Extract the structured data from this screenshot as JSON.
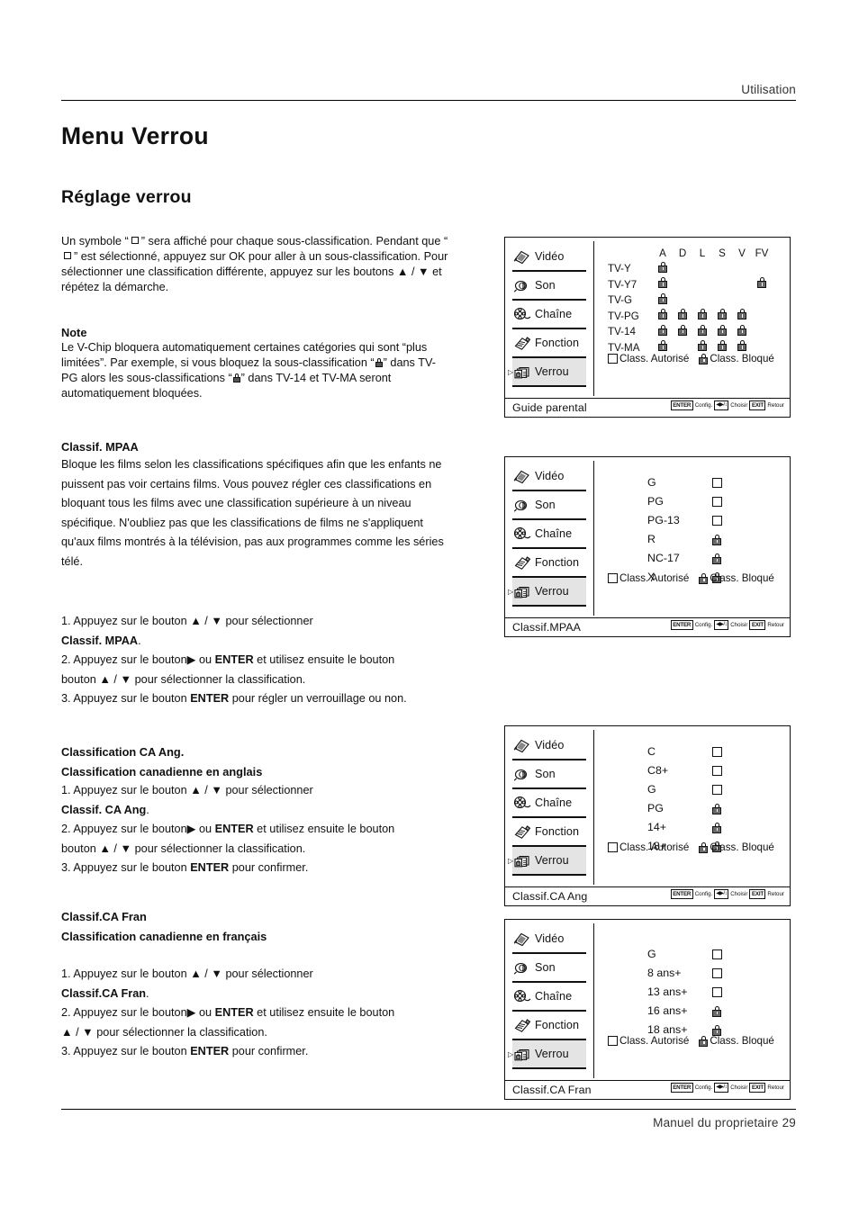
{
  "header": {
    "section": "Utilisation"
  },
  "footer": {
    "text": "Manuel du proprietaire 29"
  },
  "titles": {
    "h1": "Menu Verrou",
    "h2": "Réglage verrou"
  },
  "intro": {
    "p1_a": "Un symbole “",
    "p1_b": "” sera affiché pour chaque sous-classification. Pendant que “",
    "p1_c": "” est sélectionné, appuyez sur OK pour aller à un sous-classification. Pour sélectionner une classification différente, appuyez sur les boutons",
    "p1_d": "et répétez la démarche."
  },
  "note": {
    "title": "Note",
    "a": "Le V-Chip bloquera automatiquement certaines catégories qui sont “plus limitées”.  Par exemple, si vous bloquez la sous-classification “",
    "b": "” dans TV-PG alors les sous-classifications “",
    "c": "” dans TV-14 et TV-MA seront automatiquement bloquées."
  },
  "mpaa": {
    "title": "Classif. MPAA",
    "body": "Bloque les films selon les classifications spécifiques afin que les enfants ne puissent pas voir certains films. Vous pouvez régler ces classifications en bloquant tous les films avec une classification supérieure à un niveau spécifique. N'oubliez pas que les classifications de films ne s'appliquent qu'aux films montrés à la télévision, pas aux programmes comme les séries télé.",
    "step1_a": "1. Appuyez sur le bouton",
    "step1_b": "pour sélectionner",
    "step1_target": "Classif. MPAA",
    "step2_a": "2. Appuyez sur le bouton",
    "step2_b": "ou",
    "step2_enter": "ENTER",
    "step2_c": "et utilisez ensuite le bouton",
    "step2_d": "pour sélectionner la classification.",
    "step3_a": "3. Appuyez sur le bouton",
    "step3_enter": "ENTER",
    "step3_b": "pour régler un verrouillage ou non."
  },
  "ca_ang": {
    "title1": "Classification CA Ang.",
    "title2": "Classification canadienne en anglais",
    "step1_a": "1. Appuyez sur le bouton",
    "step1_b": "pour sélectionner",
    "step1_target": "Classif. CA Ang",
    "step2_a": "2. Appuyez sur le bouton",
    "step2_b": "ou",
    "step2_enter": "ENTER",
    "step2_c": "et utilisez ensuite le bouton",
    "step2_d": "pour sélectionner la classification.",
    "step3_a": "3. Appuyez sur le bouton",
    "step3_enter": "ENTER",
    "step3_b": "pour confirmer."
  },
  "ca_fran": {
    "title1": "Classif.CA Fran",
    "title2": "Classification canadienne en français",
    "step1_a": "1. Appuyez sur le bouton",
    "step1_b": "pour sélectionner",
    "step1_target": "Classif.CA Fran",
    "step2_a": "2. Appuyez sur le bouton",
    "step2_b": "ou",
    "step2_enter": "ENTER",
    "step2_c": "et utilisez ensuite le bouton",
    "step2_d": "pour sélectionner la classification.",
    "step3_a": "3. Appuyez sur le bouton",
    "step3_enter": "ENTER",
    "step3_b": "pour confirmer."
  },
  "osd_menu": {
    "items": [
      {
        "label": "Vidéo",
        "icon": "video-icon",
        "selected": false
      },
      {
        "label": "Son",
        "icon": "sound-icon",
        "selected": false
      },
      {
        "label": "Chaîne",
        "icon": "channel-icon",
        "selected": false
      },
      {
        "label": "Fonction",
        "icon": "function-icon",
        "selected": false
      },
      {
        "label": "Verrou",
        "icon": "lock-icon",
        "selected": true
      }
    ]
  },
  "osd_legend": {
    "allowed": "Class. Autorisé",
    "blocked": "Class. Bloqué"
  },
  "osd_keys": {
    "enter": "ENTER",
    "config": "Config.",
    "dirs": "◀▶/↕",
    "choose": "Choisir",
    "exit": "EXIT",
    "back": "Retour"
  },
  "panel1": {
    "footer_title": "Guide parental",
    "columns": [
      "A",
      "D",
      "L",
      "S",
      "V",
      "FV"
    ],
    "rows": [
      {
        "label": "TV-Y",
        "locks": [
          1,
          0,
          0,
          0,
          0,
          0
        ]
      },
      {
        "label": "TV-Y7",
        "locks": [
          1,
          0,
          0,
          0,
          0,
          1
        ]
      },
      {
        "label": "TV-G",
        "locks": [
          1,
          0,
          0,
          0,
          0,
          0
        ]
      },
      {
        "label": "TV-PG",
        "locks": [
          1,
          1,
          1,
          1,
          1,
          0
        ]
      },
      {
        "label": "TV-14",
        "locks": [
          1,
          1,
          1,
          1,
          1,
          0
        ]
      },
      {
        "label": "TV-MA",
        "locks": [
          1,
          0,
          1,
          1,
          1,
          0
        ]
      }
    ]
  },
  "panel2": {
    "footer_title": "Classif.MPAA",
    "rows": [
      {
        "label": "G",
        "state": "allowed"
      },
      {
        "label": "PG",
        "state": "allowed"
      },
      {
        "label": "PG-13",
        "state": "allowed"
      },
      {
        "label": "R",
        "state": "blocked"
      },
      {
        "label": "NC-17",
        "state": "blocked"
      },
      {
        "label": "X",
        "state": "blocked"
      }
    ]
  },
  "panel3": {
    "footer_title": "Classif.CA Ang",
    "rows": [
      {
        "label": "C",
        "state": "allowed"
      },
      {
        "label": "C8+",
        "state": "allowed"
      },
      {
        "label": "G",
        "state": "allowed"
      },
      {
        "label": "PG",
        "state": "blocked"
      },
      {
        "label": "14+",
        "state": "blocked"
      },
      {
        "label": "18+",
        "state": "blocked"
      }
    ]
  },
  "panel4": {
    "footer_title": "Classif.CA Fran",
    "rows": [
      {
        "label": "G",
        "state": "allowed"
      },
      {
        "label": "8 ans+",
        "state": "allowed"
      },
      {
        "label": "13 ans+",
        "state": "allowed"
      },
      {
        "label": "16 ans+",
        "state": "blocked"
      },
      {
        "label": "18 ans+",
        "state": "blocked"
      }
    ]
  }
}
